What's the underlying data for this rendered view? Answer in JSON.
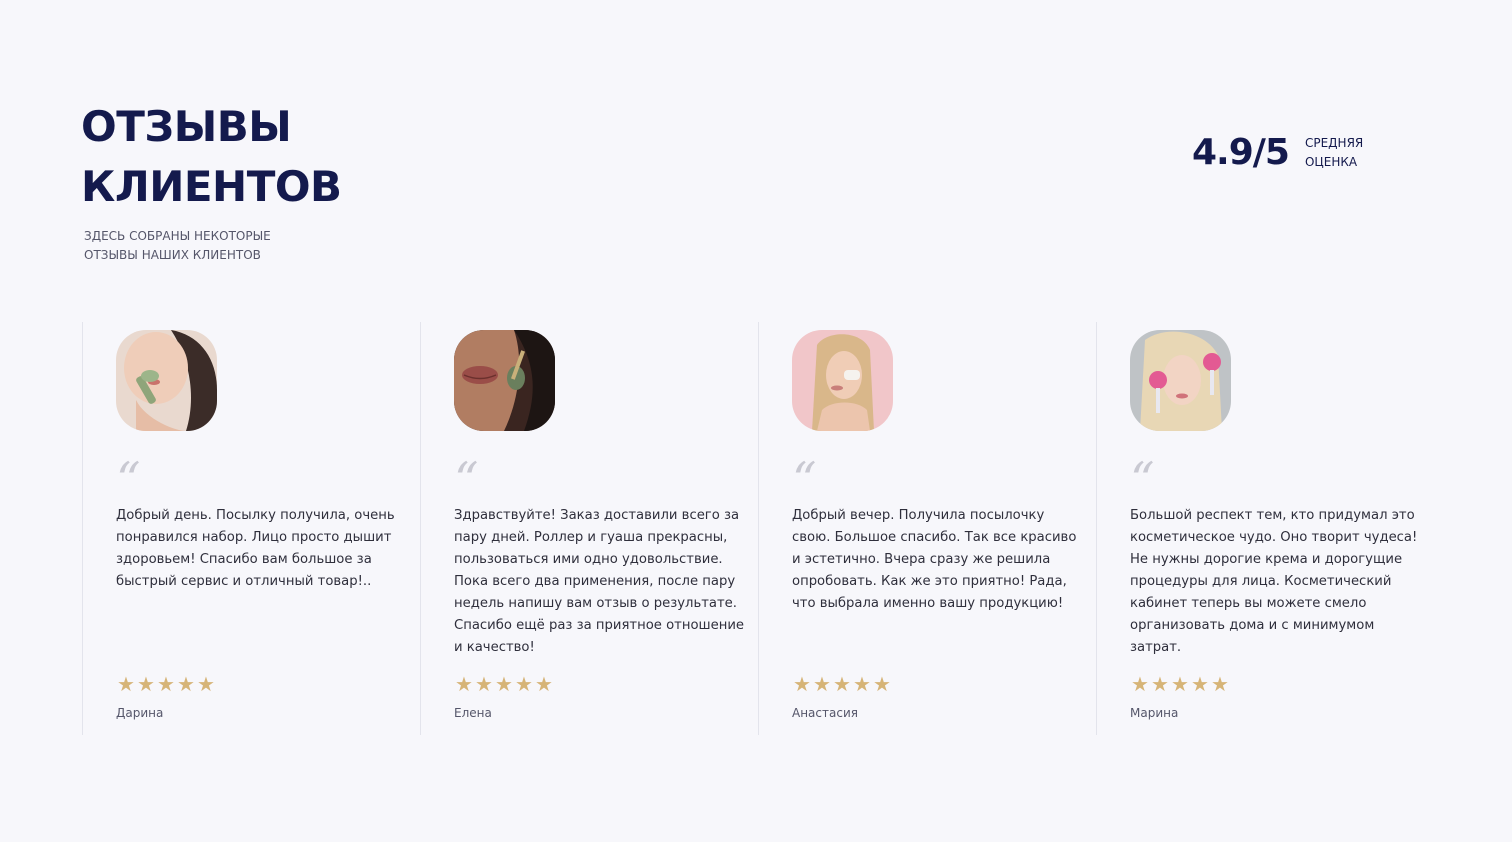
{
  "header": {
    "title_line1": "ОТЗЫВЫ",
    "title_line2": "КЛИЕНТОВ",
    "subtitle_line1": "ЗДЕСЬ СОБРАНЫ НЕКОТОРЫЕ",
    "subtitle_line2": "ОТЗЫВЫ НАШИХ КЛИЕНТОВ"
  },
  "rating": {
    "value": "4.9/5",
    "label_line1": "СРЕДНЯЯ",
    "label_line2": "ОЦЕНКА"
  },
  "colors": {
    "accent_navy": "#141a4d",
    "star_gold": "#d6b477",
    "background": "#f7f7fb"
  },
  "reviews": [
    {
      "text": "Добрый день. Посылку получила, очень понравился набор. Лицо просто дышит здоровьем! Спасибо вам большое за быстрый сервис и отличный товар!..",
      "author": "Дарина",
      "stars": 5,
      "avatar_icon": "woman-with-jade-roller-photo"
    },
    {
      "text": "Здравствуйте! Заказ доставили всего за пару дней. Роллер и гуаша прекрасны, пользоваться ими одно удовольствие. Пока всего два применения, после пару недель напишу вам отзыв о результате. Спасибо ещё раз за приятное отношение и качество!",
      "author": "Елена",
      "stars": 5,
      "avatar_icon": "woman-lips-roller-photo"
    },
    {
      "text": "Добрый вечер. Получила посылочку свою. Большое спасибо. Так все красиво и эстетично. Вчера сразу же решила опробовать. Как же это приятно! Рада, что выбрала именно вашу продукцию!",
      "author": "Анастасия",
      "stars": 5,
      "avatar_icon": "blonde-woman-gua-sha-photo"
    },
    {
      "text": "Большой респект тем, кто придумал это косметическое чудо. Оно творит чудеса! Не нужны дорогие крема и дорогущие процедуры для лица. Косметический кабинет теперь вы можете смело организовать дома и с минимумом затрат.",
      "author": "Марина",
      "stars": 5,
      "avatar_icon": "blonde-woman-ice-globes-photo"
    }
  ]
}
